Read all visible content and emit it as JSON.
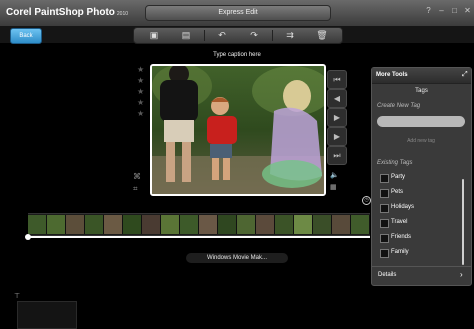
{
  "window": {
    "app_title": "Corel PaintShop Photo",
    "app_version": "2010",
    "mode_button_label": "Express Edit",
    "controls": [
      "help-icon",
      "minimize-icon",
      "maximize-icon",
      "close-icon"
    ]
  },
  "toolbar": {
    "back_label": "Back",
    "buttons": [
      "photo-fix-icon",
      "adjust-icon",
      "undo-icon",
      "redo-icon",
      "share-icon",
      "trash-icon"
    ]
  },
  "viewer": {
    "caption": "Type caption here",
    "rating_stars": 5,
    "transport": [
      "skip-start-icon",
      "step-back-icon",
      "play-icon",
      "step-forward-icon",
      "skip-end-icon"
    ]
  },
  "filmstrip": {
    "clip_name": "Windows Movie Mak..."
  },
  "panel": {
    "title": "More Tools",
    "section_title": "Tags",
    "create_label": "Create New Tag",
    "add_button_label": "Add new tag",
    "existing_label": "Existing Tags",
    "tags": [
      {
        "label": "Party",
        "checked": false
      },
      {
        "label": "Pets",
        "checked": false
      },
      {
        "label": "Holidays",
        "checked": false
      },
      {
        "label": "Travel",
        "checked": false
      },
      {
        "label": "Friends",
        "checked": false
      },
      {
        "label": "Family",
        "checked": false
      }
    ],
    "details_label": "Details"
  },
  "colors": {
    "accent_blue": "#3a9bd8",
    "panel_bg": "#3a3a3a",
    "background": "#000000"
  }
}
